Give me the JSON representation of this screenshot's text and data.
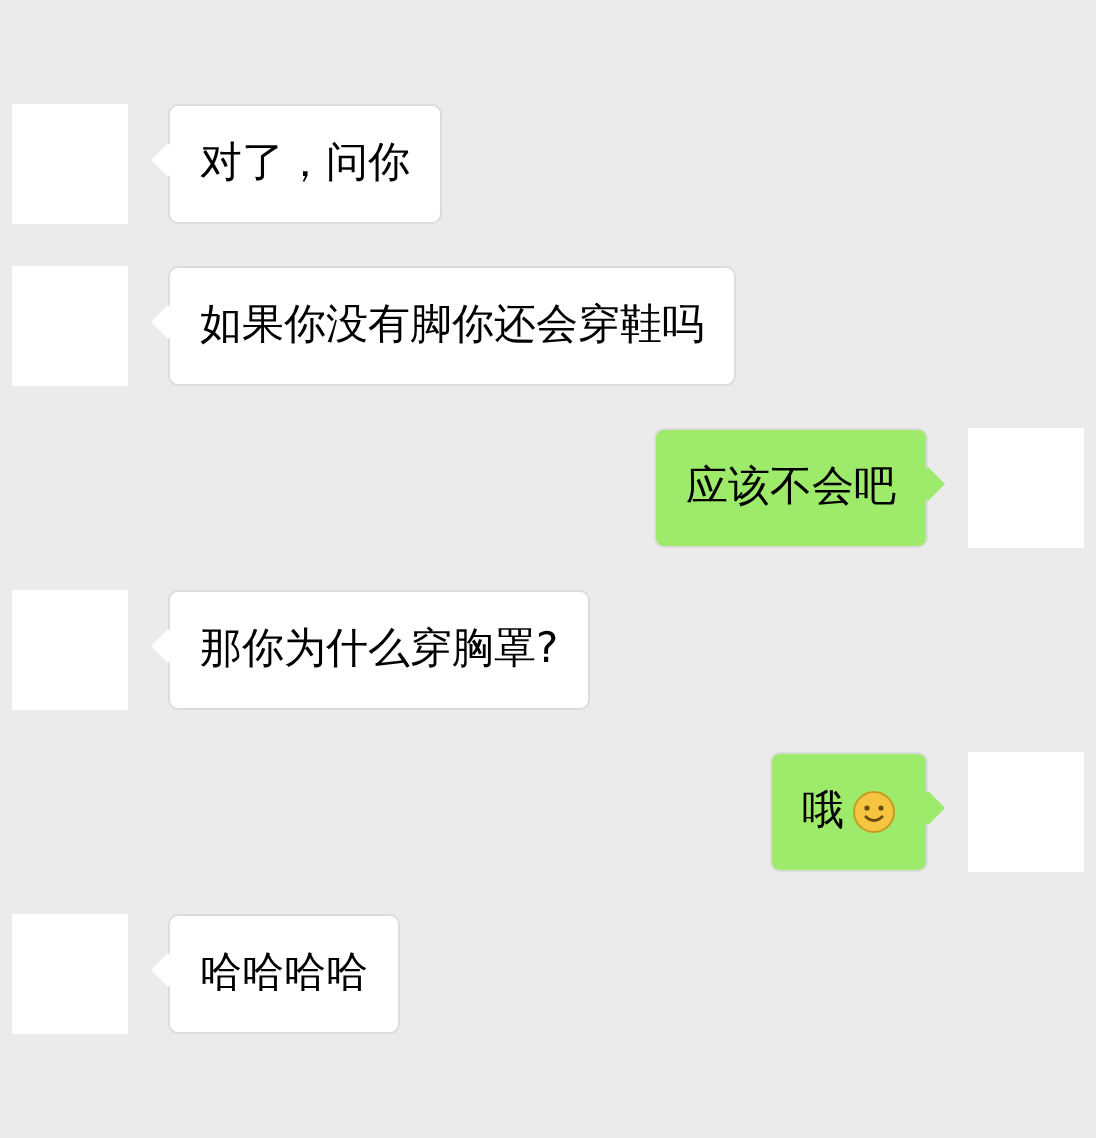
{
  "messages": [
    {
      "kind": "incoming",
      "text": "对了，问你",
      "emoji": false
    },
    {
      "kind": "incoming",
      "text": "如果你没有脚你还会穿鞋吗",
      "emoji": false
    },
    {
      "kind": "outgoing",
      "text": "应该不会吧",
      "emoji": false
    },
    {
      "kind": "incoming",
      "text": "那你为什么穿胸罩?",
      "emoji": false
    },
    {
      "kind": "outgoing",
      "text": "哦",
      "emoji": true
    },
    {
      "kind": "incoming",
      "text": "哈哈哈哈",
      "emoji": false
    }
  ]
}
